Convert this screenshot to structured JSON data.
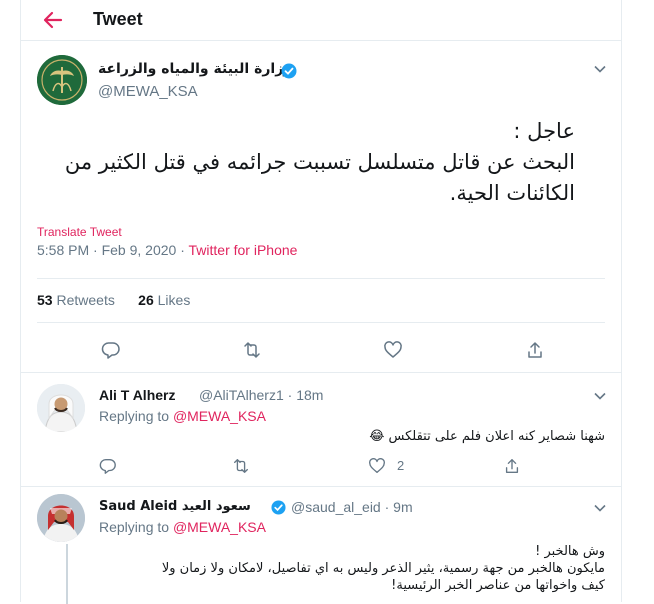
{
  "header": {
    "title": "Tweet"
  },
  "tweet": {
    "author_name": "وزارة البيئة والمياه والزراعة",
    "author_handle": "@MEWA_KSA",
    "text_line1": "عاجل :",
    "text_line2": "البحث عن قاتل متسلسل تسببت جرائمه في قتل الكثير من",
    "text_line3": "الكائنات الحية.",
    "translate_label": "Translate Tweet",
    "time": "5:58 PM · Feb 9, 2020 · ",
    "source": "Twitter for iPhone",
    "retweets_count": "53",
    "retweets_label": "Retweets",
    "likes_count": "26",
    "likes_label": "Likes"
  },
  "replies": [
    {
      "name": "Ali T Alherz",
      "handle": "@AliTAlherz1 · 18m",
      "replying_prefix": "Replying to ",
      "replying_to": "@MEWA_KSA",
      "text": "شهنا شصاير كنه اعلان فلم على تتقلكس 😂",
      "likes": "2"
    },
    {
      "name": "Saud Aleid سعود العيد",
      "handle": "@saud_al_eid · 9m",
      "replying_prefix": "Replying to ",
      "replying_to": "@MEWA_KSA",
      "text_line1": "وش هالخبر !",
      "text_line2": "مايكون هالخبر من جهة رسمية، يثير الذعر وليس به اي تفاصيل، لامكان ولا زمان ولا",
      "text_line3": "كيف واخواتها من عناصر الخبر الرئيسية!"
    }
  ],
  "colors": {
    "accent": "#e0245e",
    "verified": "#1da1f2",
    "secondary": "#657786",
    "border": "#e6ecf0"
  }
}
